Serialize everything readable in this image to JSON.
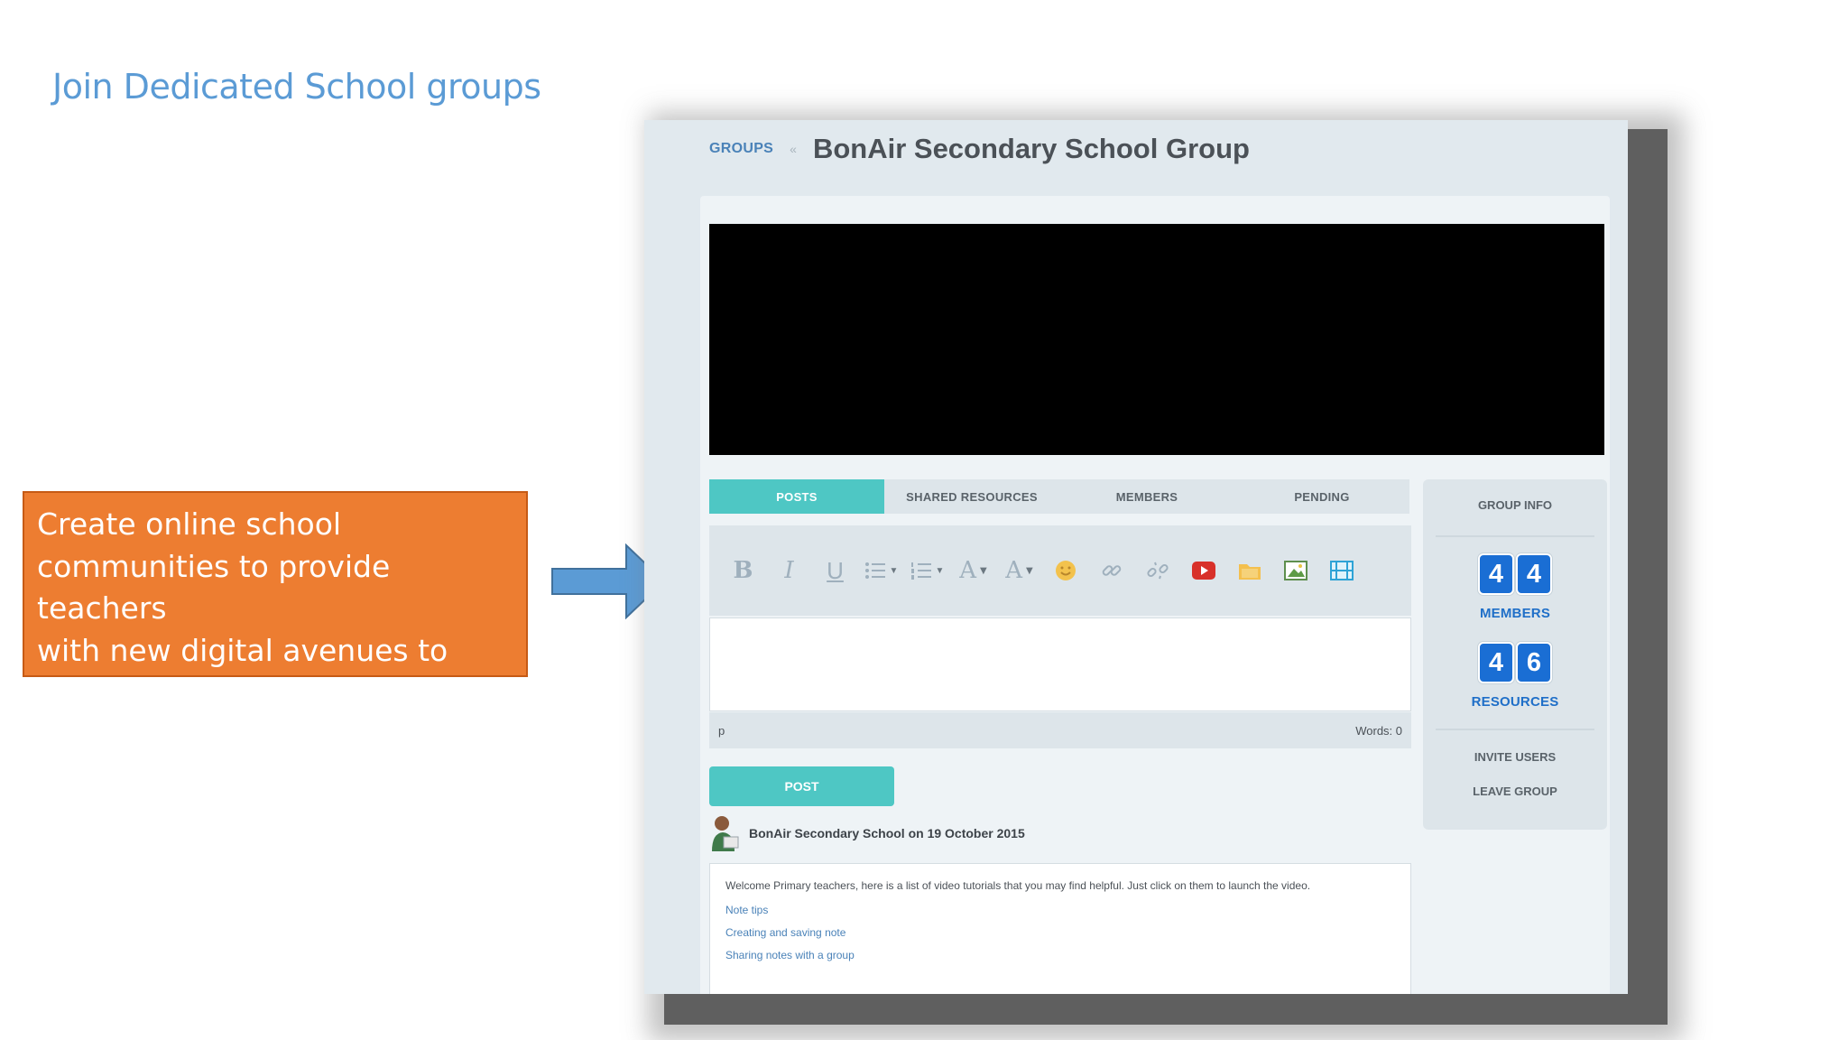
{
  "slide": {
    "title": "Join Dedicated School groups",
    "callout": "Create online school\ncommunities to provide teachers\nwith new digital avenues to\nreach their students"
  },
  "colors": {
    "title_blue": "#5b9bd5",
    "callout_orange": "#ed7d31",
    "arrow_blue": "#5b9bd5",
    "teal_accent": "#4ec7c4",
    "counter_blue": "#1a6ed4"
  },
  "app": {
    "breadcrumb": {
      "link": "GROUPS",
      "separator": "«"
    },
    "group_title": "BonAir Secondary School Group",
    "tabs": [
      {
        "label": "POSTS",
        "active": true
      },
      {
        "label": "SHARED RESOURCES",
        "active": false
      },
      {
        "label": "MEMBERS",
        "active": false
      },
      {
        "label": "PENDING",
        "active": false
      }
    ],
    "toolbar_icons": [
      "bold-icon",
      "italic-icon",
      "underline-icon",
      "bullet-list-icon",
      "numbered-list-icon",
      "text-color-icon",
      "highlight-color-icon",
      "emoticon-icon",
      "link-icon",
      "unlink-icon",
      "youtube-icon",
      "folder-icon",
      "image-icon",
      "video-icon"
    ],
    "editor": {
      "path_label": "p",
      "word_count": "Words: 0"
    },
    "post_button": "POST",
    "post": {
      "author_line": "BonAir Secondary School on 19 October 2015",
      "message": "Welcome Primary teachers, here is a list of video tutorials that you may find helpful. Just click on them to launch the video.",
      "links": [
        "Note tips",
        "Creating and saving note",
        "Sharing notes with a group"
      ]
    },
    "group_info": {
      "title": "GROUP INFO",
      "members_digits": [
        "4",
        "4"
      ],
      "members_label": "MEMBERS",
      "resources_digits": [
        "4",
        "6"
      ],
      "resources_label": "RESOURCES",
      "invite": "INVITE USERS",
      "leave": "LEAVE GROUP"
    }
  }
}
